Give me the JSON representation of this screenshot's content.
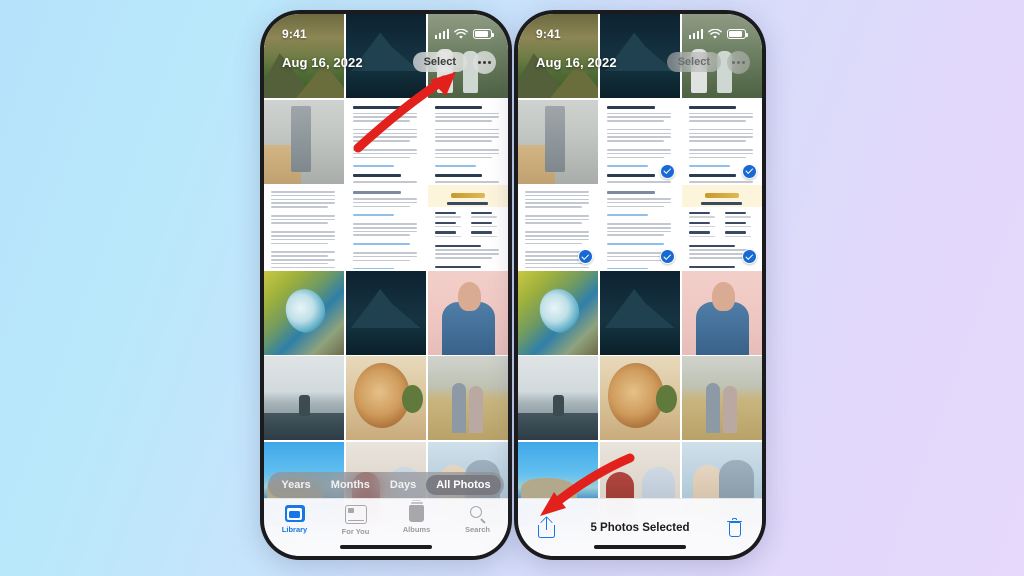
{
  "background": {
    "from": "#b6e2fb",
    "to": "#e6d9fb"
  },
  "accent": {
    "blue": "#1877e6",
    "check": "#1869d4",
    "arrow": "#e3211c"
  },
  "phones": [
    {
      "id": "before",
      "status": {
        "time": "9:41",
        "cellular_icon": "signal-bars-icon",
        "wifi_icon": "wifi-icon",
        "battery_icon": "battery-icon"
      },
      "header": {
        "date": "Aug 16, 2022",
        "select_label": "Select",
        "select_dimmed": false,
        "more_icon": "more-options-icon"
      },
      "segmented": {
        "options": [
          "Years",
          "Months",
          "Days",
          "All Photos"
        ],
        "selected": "All Photos"
      },
      "tabbar": [
        {
          "label": "Library",
          "icon": "photo-library-icon",
          "active": true
        },
        {
          "label": "For You",
          "icon": "for-you-icon",
          "active": false
        },
        {
          "label": "Albums",
          "icon": "albums-icon",
          "active": false
        },
        {
          "label": "Search",
          "icon": "search-icon",
          "active": false
        }
      ]
    },
    {
      "id": "after",
      "status": {
        "time": "9:41",
        "cellular_icon": "signal-bars-icon",
        "wifi_icon": "wifi-icon",
        "battery_icon": "battery-icon"
      },
      "header": {
        "date": "Aug 16, 2022",
        "select_label": "Select",
        "select_dimmed": true,
        "more_icon": "more-options-icon"
      },
      "selection_bar": {
        "share_icon": "share-icon",
        "count_label": "5 Photos Selected",
        "delete_icon": "trash-icon"
      }
    }
  ],
  "grid": [
    {
      "kind": "scene",
      "art": "sc-mtn-warm",
      "name": "photo-sunset-mountain",
      "selected": false
    },
    {
      "kind": "scene",
      "art": "sc-mtn-night",
      "name": "photo-night-mountain",
      "selected": false
    },
    {
      "kind": "scene",
      "art": "sc-green",
      "name": "photo-greenhouse-people",
      "selected": false
    },
    {
      "kind": "scene",
      "art": "sc-kitchen",
      "name": "photo-kitchen-intruder",
      "selected": false
    },
    {
      "kind": "doc",
      "art": "doc-article",
      "name": "screenshot-article-1",
      "selected": true
    },
    {
      "kind": "doc",
      "art": "doc-article",
      "name": "screenshot-article-2",
      "selected": true
    },
    {
      "kind": "doc",
      "art": "doc-text",
      "name": "screenshot-text-page",
      "selected": true
    },
    {
      "kind": "doc",
      "art": "doc-text2",
      "name": "screenshot-notes-page",
      "selected": true
    },
    {
      "kind": "doc",
      "art": "doc-contract",
      "name": "screenshot-contract",
      "selected": true
    },
    {
      "kind": "scene",
      "art": "sc-spring",
      "name": "photo-hot-spring",
      "selected": false
    },
    {
      "kind": "scene",
      "art": "sc-mtn-night",
      "name": "photo-starry-lake",
      "selected": false
    },
    {
      "kind": "scene",
      "art": "sc-denim",
      "name": "photo-denim-portrait",
      "selected": false
    },
    {
      "kind": "scene",
      "art": "sc-cairn",
      "name": "photo-stone-cairn",
      "selected": false
    },
    {
      "kind": "scene",
      "art": "sc-food",
      "name": "photo-food-platter",
      "selected": false
    },
    {
      "kind": "scene",
      "art": "sc-wheat",
      "name": "photo-couple-wheat",
      "selected": false
    },
    {
      "kind": "scene",
      "art": "sc-coast",
      "name": "photo-coastline",
      "selected": false
    },
    {
      "kind": "scene",
      "art": "sc-teens",
      "name": "photo-teens-indoors",
      "selected": false
    },
    {
      "kind": "scene",
      "art": "sc-piggy",
      "name": "photo-piggyback-couple",
      "selected": false
    }
  ],
  "annotations": [
    {
      "name": "arrow-to-select-button",
      "icon": "curved-arrow-icon"
    },
    {
      "name": "arrow-to-share-button",
      "icon": "curved-arrow-icon"
    }
  ]
}
